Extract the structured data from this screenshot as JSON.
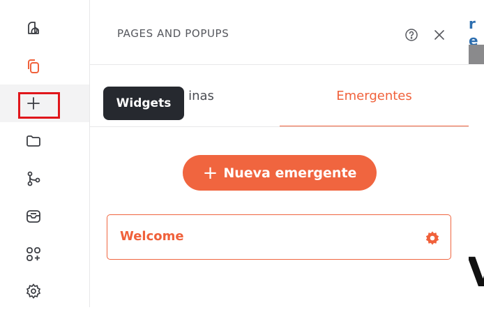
{
  "sidebar": {
    "items": [
      {
        "name": "layers",
        "icon": "layers-icon"
      },
      {
        "name": "pages",
        "icon": "copy-icon",
        "active": true
      },
      {
        "name": "widgets",
        "icon": "plus-icon",
        "highlighted": true
      },
      {
        "name": "files",
        "icon": "folder-icon"
      },
      {
        "name": "flow",
        "icon": "flow-icon"
      },
      {
        "name": "media",
        "icon": "media-icon"
      },
      {
        "name": "apps",
        "icon": "apps-add-icon"
      },
      {
        "name": "settings",
        "icon": "gear-icon"
      }
    ]
  },
  "tooltip": {
    "text": "Widgets"
  },
  "panel": {
    "title": "PAGES AND POPUPS",
    "tabs": [
      {
        "label": "inas",
        "active": false
      },
      {
        "label": "Emergentes",
        "active": true
      }
    ],
    "new_button": {
      "icon": "+",
      "label": "Nueva emergente"
    },
    "items": [
      {
        "name": "Welcome"
      }
    ]
  },
  "background_page": {
    "partial_text": "r e",
    "big_text": "V"
  },
  "colors": {
    "accent": "#f0613b",
    "highlight": "#e0161b",
    "tooltip": "#26292f"
  }
}
